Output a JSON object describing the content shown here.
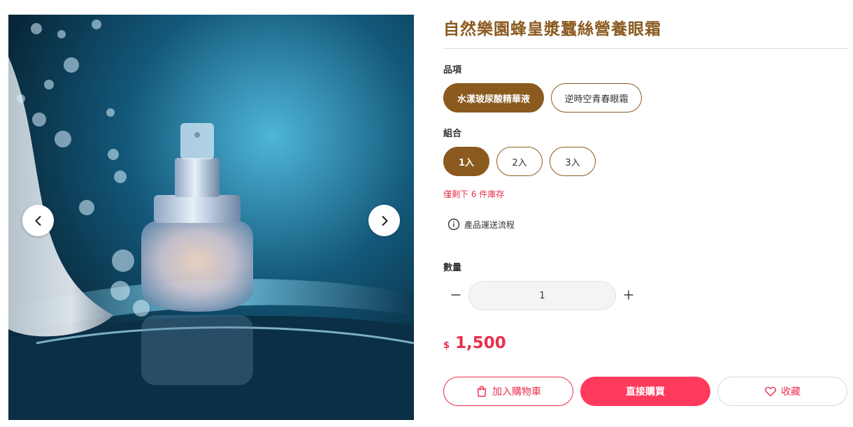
{
  "product": {
    "title": "自然樂園蜂皇漿蠶絲營養眼霜"
  },
  "gallery": {
    "prev_icon": "chevron-left-icon",
    "next_icon": "chevron-right-icon"
  },
  "options": {
    "item_label": "品項",
    "items": [
      {
        "label": "水漾玻尿酸精華液",
        "selected": true
      },
      {
        "label": "逆時空青春眼霜",
        "selected": false
      }
    ],
    "combo_label": "組合",
    "combos": [
      {
        "label": "1入",
        "selected": true
      },
      {
        "label": "2入",
        "selected": false
      },
      {
        "label": "3入",
        "selected": false
      }
    ]
  },
  "stock_notice": "僅剩下 6 件庫存",
  "shipping_link": {
    "label": "產品運送流程",
    "icon": "info-icon"
  },
  "quantity": {
    "label": "數量",
    "value": "1",
    "minus_icon": "minus-icon",
    "plus_icon": "plus-icon"
  },
  "price": {
    "currency": "$",
    "amount": "1,500"
  },
  "actions": {
    "add_to_cart": "加入購物車",
    "buy_now": "直接購買",
    "favorite": "收藏"
  },
  "colors": {
    "brand_brown": "#8a5a1f",
    "accent_red": "#e8304d",
    "buy_button": "#ff3a5c"
  }
}
